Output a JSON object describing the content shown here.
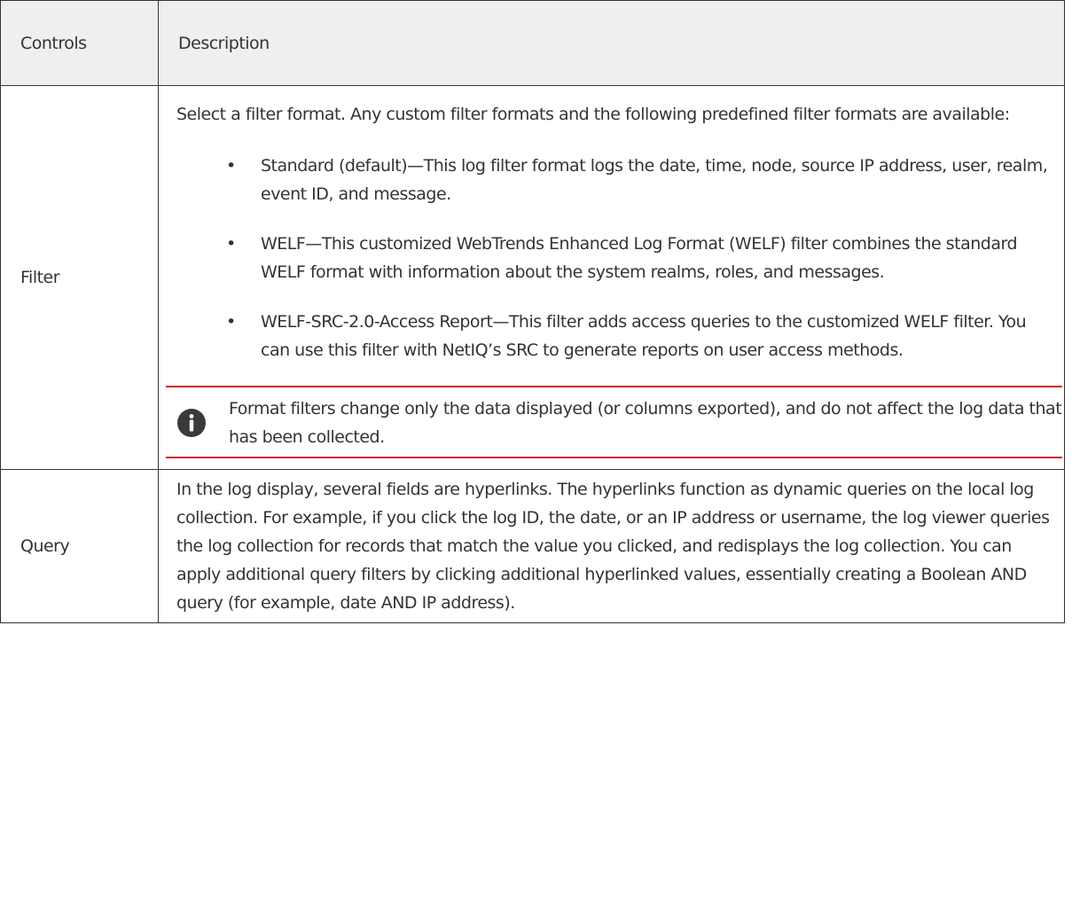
{
  "table": {
    "headers": {
      "controls": "Controls",
      "description": "Description"
    },
    "filter": {
      "control": "Filter",
      "intro": "Select a filter format. Any custom filter formats and the following predefined filter formats are available:",
      "bullet_char": "•",
      "formats": [
        "Standard (default)—This log filter format logs the date, time, node, source IP address, user, realm, event ID, and message.",
        "WELF—This customized WebTrends Enhanced Log Format (WELF) filter combines the standard WELF format with information about the system realms, roles, and messages.",
        "WELF-SRC-2.0-Access Report—This filter adds access queries to the customized WELF filter. You can use this filter with NetIQ’s SRC to generate reports on user access methods."
      ],
      "note": {
        "icon": "info-icon",
        "text": "Format filters change only the data displayed (or columns exported), and do not affect the log data that has been collected."
      }
    },
    "query": {
      "control": "Query",
      "description": "In the log display, several fields are hyperlinks. The hyperlinks function as dynamic queries on the local log collection. For example, if you click the log ID, the date, or an IP address or username, the log viewer queries the log collection for records that match the value you clicked, and redisplays the log collection. You can apply additional query filters by clicking additional hyperlinked values, essentially creating a Boolean AND query (for example, date AND IP address)."
    }
  },
  "colors": {
    "border": "#333333",
    "header_bg": "#efefef",
    "note_rule": "#d0242c",
    "icon": "#3a3a3a"
  }
}
